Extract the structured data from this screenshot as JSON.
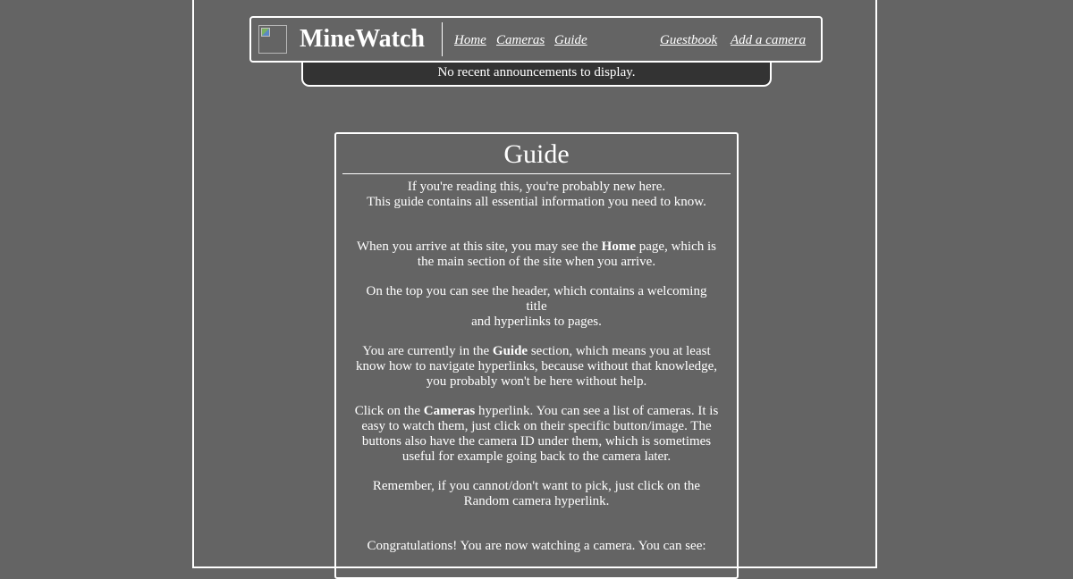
{
  "header": {
    "logo_icon": "broken-image-icon",
    "brand": "MineWatch",
    "nav": {
      "home": "Home",
      "cameras": "Cameras",
      "guide": "Guide",
      "guestbook": "Guestbook",
      "add_camera": "Add a camera"
    }
  },
  "announcements": {
    "text": "No recent announcements to display."
  },
  "guide": {
    "title": "Guide",
    "intro_1": "If you're reading this, you're probably new here.",
    "intro_2": "This guide contains all essential information you need to know.",
    "p1_a": "When you arrive at this site, you may see the ",
    "p1_bold": "Home",
    "p1_b": " page, which is",
    "p1_c": "the main section of the site when you arrive.",
    "p2_a": "On the top you can see the header, which contains a welcoming title",
    "p2_b": "and hyperlinks to pages.",
    "p3_a": "You are currently in the ",
    "p3_bold": "Guide",
    "p3_b": " section, which means you at least",
    "p3_c": "know how to navigate hyperlinks, because without that knowledge,",
    "p3_d": "you probably won't be here without help.",
    "p4_a": "Click on the ",
    "p4_bold": "Cameras",
    "p4_b": " hyperlink. You can see a list of cameras. It is",
    "p4_c": "easy to watch them, just click on their specific button/image. The",
    "p4_d": "buttons also have the camera ID under them, which is sometimes",
    "p4_e": "useful for example going back to the camera later.",
    "p5_a": "Remember, if you cannot/don't want to pick, just click on the",
    "p5_b": "Random camera hyperlink.",
    "p6_a": "Congratulations! You are now watching a camera. You can see:"
  },
  "colors": {
    "background": "#646464",
    "announcement_bar": "#333333",
    "text": "#ffffff",
    "border": "#ffffff"
  }
}
